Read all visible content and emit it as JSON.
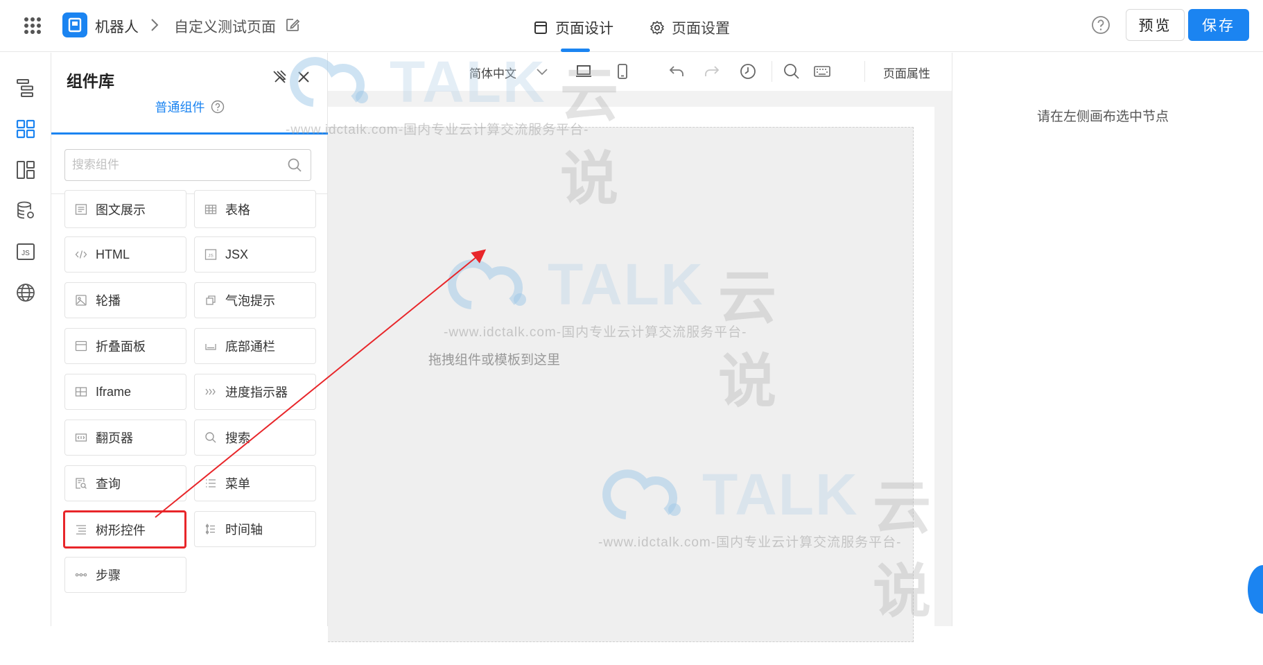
{
  "header": {
    "app_name": "机器人",
    "page_name": "自定义测试页面",
    "tabs": [
      {
        "label": "页面设计",
        "icon": "layout-icon",
        "active": true
      },
      {
        "label": "页面设置",
        "icon": "gear-icon",
        "active": false
      }
    ],
    "preview_label": "预览",
    "save_label": "保存",
    "accent_color": "#1b84f1"
  },
  "rail": {
    "items": [
      "outline-tree-icon",
      "components-icon",
      "layout-panels-icon",
      "datasource-icon",
      "js-code-icon",
      "globe-icon"
    ]
  },
  "panel": {
    "title": "组件库",
    "tab_label": "普通组件",
    "search_placeholder": "搜索组件",
    "components": [
      {
        "label": "图文展示",
        "icon": "text-image-icon"
      },
      {
        "label": "表格",
        "icon": "table-icon"
      },
      {
        "label": "HTML",
        "icon": "code-icon"
      },
      {
        "label": "JSX",
        "icon": "jsx-icon"
      },
      {
        "label": "轮播",
        "icon": "carousel-icon"
      },
      {
        "label": "气泡提示",
        "icon": "popover-icon"
      },
      {
        "label": "折叠面板",
        "icon": "collapse-icon"
      },
      {
        "label": "底部通栏",
        "icon": "footer-bar-icon"
      },
      {
        "label": "Iframe",
        "icon": "iframe-icon"
      },
      {
        "label": "进度指示器",
        "icon": "progress-icon"
      },
      {
        "label": "翻页器",
        "icon": "pager-icon"
      },
      {
        "label": "搜索",
        "icon": "search-icon"
      },
      {
        "label": "查询",
        "icon": "query-icon"
      },
      {
        "label": "菜单",
        "icon": "menu-icon"
      },
      {
        "label": "树形控件",
        "icon": "tree-icon",
        "highlighted": true
      },
      {
        "label": "时间轴",
        "icon": "timeline-icon"
      },
      {
        "label": "步骤",
        "icon": "steps-icon"
      }
    ]
  },
  "toolbar": {
    "language": "简体中文",
    "page_props_label": "页面属性"
  },
  "canvas": {
    "drop_hint": "拖拽组件或模板到这里"
  },
  "props": {
    "empty_hint": "请在左侧画布选中节点"
  },
  "watermark": {
    "word": "TALK",
    "brand_cn": "云说",
    "line": "-www.idctalk.com-国内专业云计算交流服务平台-"
  }
}
